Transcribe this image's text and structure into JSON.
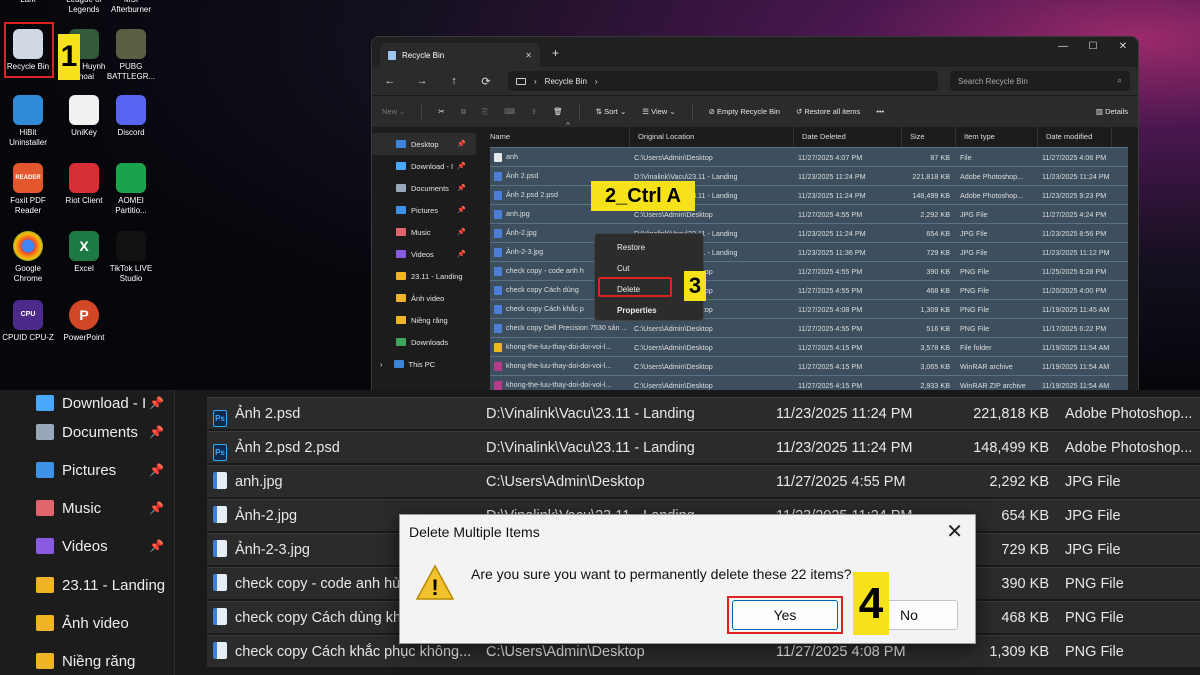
{
  "desktop": {
    "icons": [
      {
        "label": "Lark",
        "name": "lark-icon",
        "top_cut": true
      },
      {
        "label": "League of Legends",
        "name": "league-of-legends-icon",
        "top_cut": true
      },
      {
        "label": "MSI Afterburner",
        "name": "msi-afterburner-icon",
        "top_cut": true
      },
      {
        "label": "Recycle Bin",
        "name": "recycle-bin-icon"
      },
      {
        "label": "Minh Huynh Thoai",
        "name": "minh-huynh-thoai-icon"
      },
      {
        "label": "PUBG BATTLEGR...",
        "name": "pubg-icon"
      },
      {
        "label": "HiBit Uninstaller",
        "name": "hibit-uninstaller-icon"
      },
      {
        "label": "UniKey",
        "name": "unikey-icon"
      },
      {
        "label": "Discord",
        "name": "discord-icon"
      },
      {
        "label": "Foxit PDF Reader",
        "name": "foxit-pdf-reader-icon"
      },
      {
        "label": "Riot Client",
        "name": "riot-client-icon"
      },
      {
        "label": "AOMEI Partitio...",
        "name": "aomei-partition-icon"
      },
      {
        "label": "Google Chrome",
        "name": "google-chrome-icon"
      },
      {
        "label": "Excel",
        "name": "excel-icon"
      },
      {
        "label": "TikTok LIVE Studio",
        "name": "tiktok-live-studio-icon"
      },
      {
        "label": "CPUID CPU-Z",
        "name": "cpuid-cpu-z-icon"
      },
      {
        "label": "PowerPoint",
        "name": "powerpoint-icon"
      }
    ],
    "icon_glyphs": {
      "reader": "READER",
      "excel": "X",
      "ppt": "P",
      "cpuz": "CPU"
    }
  },
  "steps": {
    "one": "1",
    "two": "2_Ctrl A",
    "three": "3",
    "four": "4"
  },
  "explorer": {
    "tab_title": "Recycle Bin",
    "tab_close": "✕",
    "new_tab": "+",
    "window_controls": [
      "—",
      "☐",
      "✕"
    ],
    "nav": {
      "back": "←",
      "forward": "→",
      "up": "↑",
      "refresh": "⟳"
    },
    "path": "Recycle Bin",
    "path_sep": "›",
    "search_placeholder": "Search Recycle Bin",
    "search_icon": "⌕",
    "toolbar": {
      "new": "New",
      "sort": "Sort",
      "view": "View",
      "empty": "Empty Recycle Bin",
      "restore_all": "Restore all items",
      "more": "•••",
      "details": "Details"
    },
    "toolbar_glyphs": {
      "cut": "✂",
      "copy": "⧉",
      "paste": "⎘",
      "rename": "⌨",
      "share": "⇪",
      "delete": "🗑",
      "caret": "⌄",
      "sort": "⇅",
      "view": "☰",
      "empty": "⊘",
      "restore": "↺",
      "details": "▥"
    },
    "sidebar": [
      {
        "label": "Desktop",
        "color": "#3b86d9",
        "pinned": true,
        "active": true
      },
      {
        "label": "Download - I",
        "color": "#4aa8ff",
        "pinned": true
      },
      {
        "label": "Documents",
        "color": "#9aa7b8",
        "pinned": true
      },
      {
        "label": "Pictures",
        "color": "#3f93e6",
        "pinned": true
      },
      {
        "label": "Music",
        "color": "#e0656d",
        "pinned": true
      },
      {
        "label": "Videos",
        "color": "#8a5be0",
        "pinned": true
      },
      {
        "label": "23.11 - Landing",
        "color": "#f0b429"
      },
      {
        "label": "Ảnh video",
        "color": "#f0b429"
      },
      {
        "label": "Niềng răng",
        "color": "#f0b429"
      },
      {
        "label": "Downloads",
        "color": "#3fa65a"
      },
      {
        "label": "This PC",
        "color": "#3b86d9",
        "expander": "›"
      }
    ],
    "pin_glyph": "📌",
    "columns": [
      "Name",
      "Original Location",
      "Date Deleted",
      "Size",
      "Item type",
      "Date modified"
    ],
    "sort_indicator": "^",
    "files": [
      {
        "name": "anh",
        "location": "C:\\Users\\Admin\\Desktop",
        "deleted": "11/27/2025 4:07 PM",
        "size": "87 KB",
        "type": "File",
        "modified": "11/27/2025 4:06 PM"
      },
      {
        "name": "Ảnh 2.psd",
        "location": "D:\\Vinalink\\Vacu\\23.11 - Landing",
        "deleted": "11/23/2025 11:24 PM",
        "size": "221,818 KB",
        "type": "Adobe Photoshop...",
        "modified": "11/23/2025 11:24 PM"
      },
      {
        "name": "Ảnh 2.psd 2.psd",
        "location": "D:\\Vinalink\\Vacu\\23.11 - Landing",
        "deleted": "11/23/2025 11:24 PM",
        "size": "148,499 KB",
        "type": "Adobe Photoshop...",
        "modified": "11/23/2025 9:23 PM"
      },
      {
        "name": "anh.jpg",
        "location": "C:\\Users\\Admin\\Desktop",
        "deleted": "11/27/2025 4:55 PM",
        "size": "2,292 KB",
        "type": "JPG File",
        "modified": "11/27/2025 4:24 PM"
      },
      {
        "name": "Ảnh-2.jpg",
        "location": "D:\\Vinalink\\Vacu\\23.11 - Landing",
        "deleted": "11/23/2025 11:24 PM",
        "size": "654 KB",
        "type": "JPG File",
        "modified": "11/23/2025 8:56 PM"
      },
      {
        "name": "Ảnh-2-3.jpg",
        "location": "D:\\Vinalink\\Vacu\\23.11 - Landing",
        "deleted": "11/23/2025 11:36 PM",
        "size": "729 KB",
        "type": "JPG File",
        "modified": "11/23/2025 11:12 PM"
      },
      {
        "name": "check copy - code anh h",
        "location": "C:\\Users\\Admin\\Desktop",
        "deleted": "11/27/2025 4:55 PM",
        "size": "390 KB",
        "type": "PNG File",
        "modified": "11/25/2025 8:28 PM"
      },
      {
        "name": "check copy Cách dùng",
        "location": "C:\\Users\\Admin\\Desktop",
        "deleted": "11/27/2025 4:55 PM",
        "size": "468 KB",
        "type": "PNG File",
        "modified": "11/20/2025 4:00 PM"
      },
      {
        "name": "check copy Cách khắc p",
        "location": "C:\\Users\\Admin\\Desktop",
        "deleted": "11/27/2025 4:08 PM",
        "size": "1,309 KB",
        "type": "PNG File",
        "modified": "11/19/2025 11:45 AM"
      },
      {
        "name": "check copy Dell Precision 7530 sản ...",
        "location": "C:\\Users\\Admin\\Desktop",
        "deleted": "11/27/2025 4:55 PM",
        "size": "516 KB",
        "type": "PNG File",
        "modified": "11/17/2025 6:22 PM"
      },
      {
        "name": "khong-the-luu-thay-doi-doi-voi-l...",
        "location": "C:\\Users\\Admin\\Desktop",
        "deleted": "11/27/2025 4:15 PM",
        "size": "3,578 KB",
        "type": "File folder",
        "modified": "11/19/2025 11:54 AM"
      },
      {
        "name": "khong-the-luu-thay-doi-doi-voi-l...",
        "location": "C:\\Users\\Admin\\Desktop",
        "deleted": "11/27/2025 4:15 PM",
        "size": "3,065 KB",
        "type": "WinRAR archive",
        "modified": "11/19/2025 11:54 AM"
      },
      {
        "name": "khong-the-luu-thay-doi-doi-voi-l...",
        "location": "C:\\Users\\Admin\\Desktop",
        "deleted": "11/27/2025 4:15 PM",
        "size": "2,933 KB",
        "type": "WinRAR ZIP archive",
        "modified": "11/19/2025 11:54 AM"
      }
    ],
    "context_menu": [
      "Restore",
      "Cut",
      "Delete",
      "Properties"
    ]
  },
  "zoom": {
    "sidebar": [
      {
        "label": "Download - I",
        "color": "#4aa8ff",
        "pinned": true
      },
      {
        "label": "Documents",
        "color": "#9aa7b8",
        "pinned": true
      },
      {
        "label": "Pictures",
        "color": "#3f93e6",
        "pinned": true
      },
      {
        "label": "Music",
        "color": "#e0656d",
        "pinned": true
      },
      {
        "label": "Videos",
        "color": "#8a5be0",
        "pinned": true
      },
      {
        "label": "23.11 - Landing",
        "color": "#f0b429"
      },
      {
        "label": "Ảnh video",
        "color": "#f0b429"
      },
      {
        "label": "Niềng răng",
        "color": "#f0b429"
      }
    ],
    "rows": [
      {
        "name": "Ảnh 2.psd",
        "location": "D:\\Vinalink\\Vacu\\23.11 - Landing",
        "deleted": "11/23/2025 11:24 PM",
        "size": "221,818 KB",
        "type": "Adobe Photoshop...",
        "icon": "psd"
      },
      {
        "name": "Ảnh 2.psd 2.psd",
        "location": "D:\\Vinalink\\Vacu\\23.11 - Landing",
        "deleted": "11/23/2025 11:24 PM",
        "size": "148,499 KB",
        "type": "Adobe Photoshop...",
        "icon": "psd"
      },
      {
        "name": "anh.jpg",
        "location": "C:\\Users\\Admin\\Desktop",
        "deleted": "11/27/2025 4:55 PM",
        "size": "2,292 KB",
        "type": "JPG File",
        "icon": "img"
      },
      {
        "name": "Ảnh-2.jpg",
        "location": "D:\\Vinalink\\Vacu\\23.11 - Landing",
        "deleted": "11/23/2025 11:24 PM",
        "size": "654 KB",
        "type": "JPG File",
        "icon": "img"
      },
      {
        "name": "Ảnh-2-3.jpg",
        "location": "",
        "deleted": "",
        "size": "729 KB",
        "type": "JPG File",
        "icon": "img"
      },
      {
        "name": "check copy - code anh hù",
        "location": "",
        "deleted": "",
        "size": "390 KB",
        "type": "PNG File",
        "icon": "img"
      },
      {
        "name": "check copy Cách dùng kh",
        "location": "",
        "deleted": "",
        "size": "468 KB",
        "type": "PNG File",
        "icon": "img"
      },
      {
        "name": "check copy Cách khắc phục không...",
        "location": "C:\\Users\\Admin\\Desktop",
        "deleted": "11/27/2025 4:08 PM",
        "size": "1,309 KB",
        "type": "PNG File",
        "icon": "img"
      }
    ],
    "psd_glyph": "Ps",
    "warn_glyph": "!",
    "dialog": {
      "title": "Delete Multiple Items",
      "close": "✕",
      "message": "Are you sure you want to permanently delete these 22 items?",
      "yes": "Yes",
      "no": "No"
    }
  }
}
